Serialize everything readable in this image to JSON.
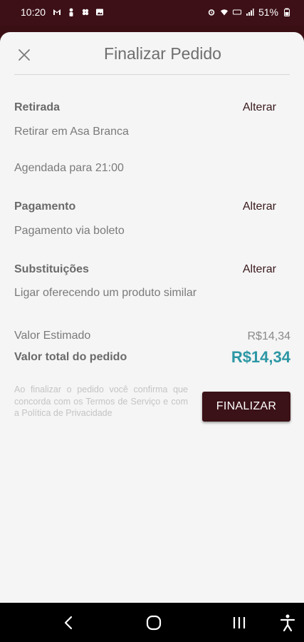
{
  "status_bar": {
    "time": "10:20",
    "battery": "51%"
  },
  "header": {
    "title": "Finalizar Pedido"
  },
  "pickup": {
    "label": "Retirada",
    "action": "Alterar",
    "location": "Retirar em Asa Branca",
    "schedule": "Agendada para 21:00"
  },
  "payment": {
    "label": "Pagamento",
    "action": "Alterar",
    "method": "Pagamento via boleto"
  },
  "substitutions": {
    "label": "Substituições",
    "action": "Alterar",
    "option": "Ligar oferecendo um produto similar"
  },
  "summary": {
    "estimated_label": "Valor Estimado",
    "estimated_value": "R$14,34",
    "total_label": "Valor total do pedido",
    "total_value": "R$14,34"
  },
  "footer": {
    "terms_text": "Ao finalizar o pedido você confirma que concorda com os Termos de Serviço e com a Política de Privacidade",
    "finalize_label": "FINALIZAR"
  },
  "colors": {
    "brand": "#3b1217",
    "total_accent": "#2c97a5"
  }
}
